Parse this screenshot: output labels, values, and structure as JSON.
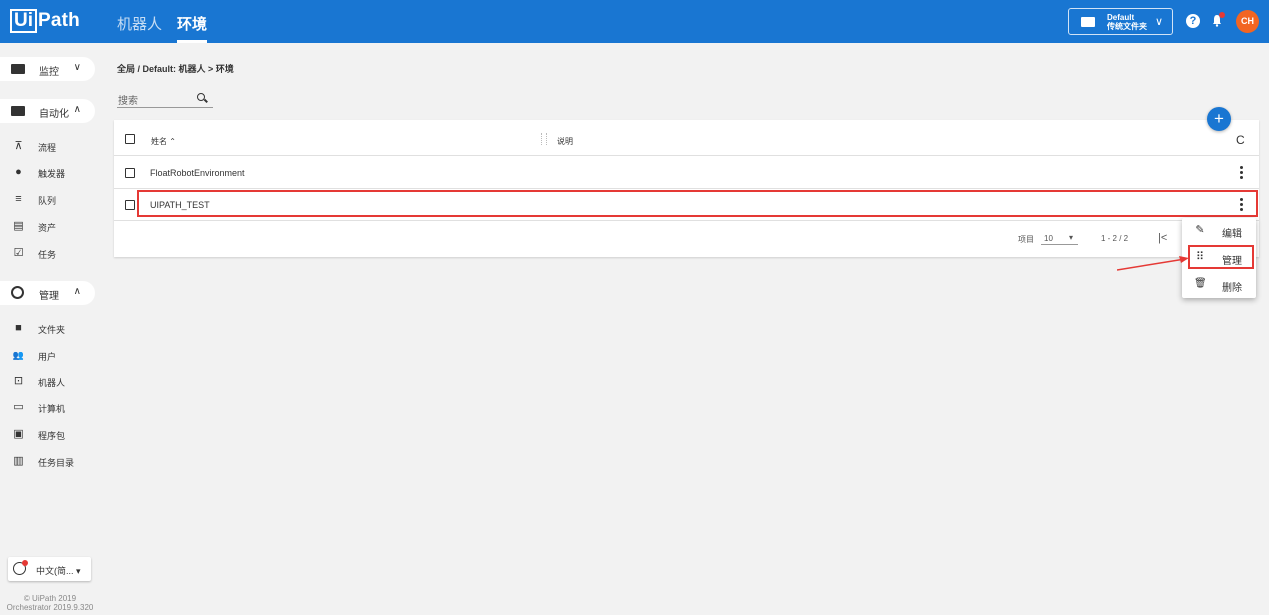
{
  "header": {
    "logo_box": "Ui",
    "logo_text": "Path",
    "tabs": [
      {
        "label": "机器人",
        "active": false
      },
      {
        "label": "环境",
        "active": true
      }
    ],
    "folder": {
      "line1": "Default",
      "line2": "传统文件夹"
    },
    "help": "?",
    "avatar": "CH",
    "accent": "#1976d2"
  },
  "sidebar": {
    "sections": [
      {
        "label": "监控",
        "arrow": "∨",
        "icon": "folder-icon"
      },
      {
        "label": "自动化",
        "arrow": "∧",
        "icon": "folder-icon"
      },
      {
        "label": "管理",
        "arrow": "∧",
        "icon": "globe-icon"
      }
    ],
    "automation_items": [
      {
        "label": "流程",
        "icon": "sitemap-icon",
        "glyph": "⊼"
      },
      {
        "label": "触发器",
        "icon": "bolt-icon",
        "glyph": "●"
      },
      {
        "label": "队列",
        "icon": "queue-icon",
        "glyph": "≡"
      },
      {
        "label": "资产",
        "icon": "asset-icon",
        "glyph": "▤"
      },
      {
        "label": "任务",
        "icon": "clipboard-icon",
        "glyph": "☑"
      }
    ],
    "admin_items": [
      {
        "label": "文件夹",
        "icon": "folder-icon",
        "glyph": "■"
      },
      {
        "label": "用户",
        "icon": "users-icon",
        "glyph": "👥"
      },
      {
        "label": "机器人",
        "icon": "robot-icon",
        "glyph": "⊡"
      },
      {
        "label": "计算机",
        "icon": "monitor-icon",
        "glyph": "▭"
      },
      {
        "label": "程序包",
        "icon": "package-icon",
        "glyph": "▣"
      },
      {
        "label": "任务目录",
        "icon": "catalog-icon",
        "glyph": "▥"
      }
    ],
    "language": "中文(简...",
    "copyright_line1": "© UiPath 2019",
    "copyright_line2": "Orchestrator 2019.9.320"
  },
  "main": {
    "breadcrumb": "全局 / Default: 机器人 > 环境",
    "search_placeholder": "搜索",
    "add_label": "+",
    "refresh_glyph": "C",
    "columns": {
      "name": "姓名 ⌃",
      "description": "说明"
    },
    "rows": [
      {
        "name": "FloatRobotEnvironment"
      },
      {
        "name": "UIPATH_TEST"
      }
    ],
    "pager": {
      "items_label": "项目",
      "page_size": "10",
      "range": "1 - 2 / 2",
      "first": "|<"
    }
  },
  "context_menu": {
    "items": [
      {
        "label": "编辑",
        "icon": "pencil-icon",
        "glyph": "✎"
      },
      {
        "label": "管理",
        "icon": "grid-icon",
        "glyph": "⠿"
      },
      {
        "label": "删除",
        "icon": "trash-icon",
        "glyph": "🗑"
      }
    ]
  },
  "annotation_color": "#e53935"
}
